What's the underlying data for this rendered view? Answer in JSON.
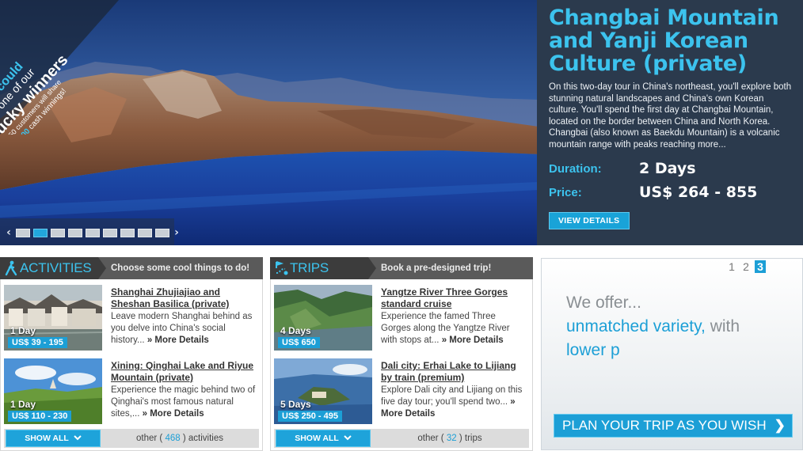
{
  "promo": {
    "line1": "You could",
    "line2": "be one of our",
    "line3": "lucky winners",
    "line4": "2 of 50 customers will share",
    "line5_pre": "in",
    "line5_amount": "$3,000",
    "line5_post": "cash winnings!"
  },
  "hero": {
    "title": "Changbai Mountain and Yanji Korean Culture (private)",
    "description": "On this two-day tour in China's northeast, you'll explore both stunning natural landscapes and China's own Korean culture. You'll spend the first day at Changbai Mountain, located on the border between China and North Korea. Changbai (also known as Baekdu Mountain) is a volcanic mountain range with peaks reaching more...",
    "duration_label": "Duration:",
    "duration_value": "2 Days",
    "price_label": "Price:",
    "price_value": "US$ 264 - 855",
    "view_button": "VIEW DETAILS",
    "slide_count": 9,
    "active_slide": 2
  },
  "activities": {
    "title": "ACTIVITIES",
    "subtitle": "Choose some cool things to do!",
    "items": [
      {
        "title": "Shanghai Zhujiajiao and Sheshan Basilica (private)",
        "desc": "Leave modern Shanghai behind as you delve into China's social history...",
        "more": "» More Details",
        "days": "1 Day",
        "price": "US$ 39 - 195"
      },
      {
        "title": "Xining: Qinghai Lake and Riyue Mountain (private)",
        "desc": "Experience the magic behind two of Qinghai's most famous natural sites,...",
        "more": "» More Details",
        "days": "1 Day",
        "price": "US$ 110 - 230"
      }
    ],
    "show_all": "SHOW ALL",
    "other_pre": "other (",
    "other_count": "468",
    "other_post": ") activities"
  },
  "trips": {
    "title": "TRIPS",
    "subtitle": "Book a pre-designed trip!",
    "items": [
      {
        "title": "Yangtze River Three Gorges standard cruise",
        "desc": "Experience the famed Three Gorges along the Yangtze River with stops at...",
        "more": "» More Details",
        "days": "4 Days",
        "price": "US$ 650"
      },
      {
        "title": "Dali city: Erhai Lake to Lijiang by train (premium)",
        "desc": "Explore Dali city and Lijiang on this five day tour; you'll spend two...",
        "more": "» More Details",
        "days": "5 Days",
        "price": "US$ 250 - 495"
      }
    ],
    "show_all": "SHOW ALL",
    "other_pre": "other (",
    "other_count": "32",
    "other_post": ") trips"
  },
  "offer": {
    "pages": [
      "1",
      "2",
      "3"
    ],
    "current_page": "3",
    "line1": "We offer...",
    "line2_a": "unmatched variety,",
    "line2_b": "with",
    "line3": "lower p",
    "plan_button": "PLAN YOUR TRIP AS YOU WISH",
    "chevron": "❯"
  },
  "colors": {
    "accent": "#1c9fd6",
    "accent_light": "#3cc3ee",
    "panel_dark": "#2b3a4d",
    "header_dark": "#3c3c3c"
  }
}
